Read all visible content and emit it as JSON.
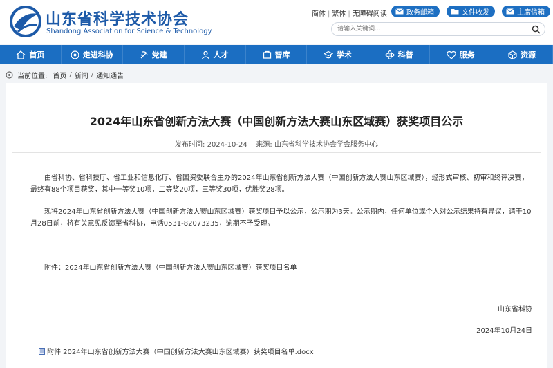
{
  "header": {
    "org_name_cn": "山东省科学技术协会",
    "org_name_en": "Shandong Association for Science & Technology",
    "top_links": [
      "简体",
      "繁体",
      "无障碍阅读"
    ],
    "buttons": [
      "政务邮箱",
      "文件收发",
      "主席信箱"
    ],
    "search_placeholder": "请输入关键词..."
  },
  "nav": {
    "items": [
      {
        "label": "首页",
        "icon": "home-icon"
      },
      {
        "label": "走进科协",
        "icon": "about-icon"
      },
      {
        "label": "党建",
        "icon": "party-icon"
      },
      {
        "label": "人才",
        "icon": "person-icon"
      },
      {
        "label": "智库",
        "icon": "think-tank-icon"
      },
      {
        "label": "学术",
        "icon": "academic-icon"
      },
      {
        "label": "科普",
        "icon": "science-icon"
      },
      {
        "label": "服务",
        "icon": "service-icon"
      },
      {
        "label": "资源",
        "icon": "resource-icon"
      }
    ]
  },
  "breadcrumb": {
    "prefix": "当前位置:",
    "items": [
      "首页",
      "新闻",
      "通知通告"
    ]
  },
  "article": {
    "title": "2024年山东省创新方法大赛（中国创新方法大赛山东区域赛）获奖项目公示",
    "publish_label": "发布时间:",
    "publish_date": "2024-10-24",
    "source_label": "来源:",
    "source": "山东省科学技术协会学会服务中心",
    "paragraph1": "由省科协、省科技厅、省工业和信息化厅、省国资委联合主办的2024年山东省创新方法大赛（中国创新方法大赛山东区域赛），经形式审核、初审和终评决赛，最终有88个项目获奖，其中一等奖10项，二等奖20项，三等奖30项，优胜奖28项。",
    "paragraph2": "现将2024年山东省创新方法大赛（中国创新方法大赛山东区域赛）获奖项目予以公示，公示期为3天。公示期内，任何单位或个人对公示结果持有异议，请于10月28日前，将有关意见反馈至省科协，电话0531-82073235，逾期不予受理。",
    "attachment_text": "附件：2024年山东省创新方法大赛（中国创新方法大赛山东区域赛）获奖项目名单",
    "signature": "山东省科协",
    "date": "2024年10月24日",
    "file_name": "附件 2024年山东省创新方法大赛（中国创新方法大赛山东区域赛）获奖项目名单.docx"
  },
  "colors": {
    "primary": "#1b6ec2",
    "brand_text": "#1d5aa8"
  }
}
